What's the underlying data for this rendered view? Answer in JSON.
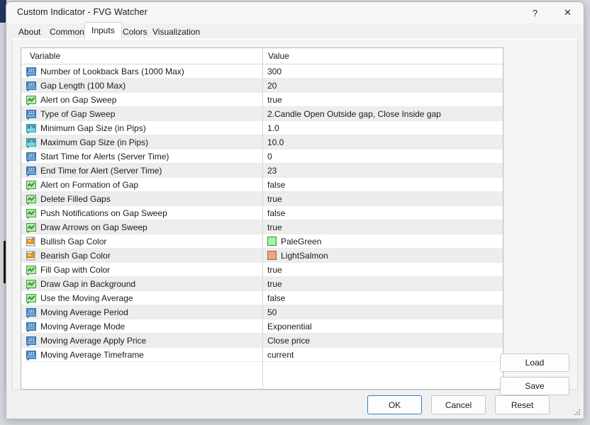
{
  "window": {
    "title": "Custom Indicator - FVG Watcher",
    "help_label": "?",
    "close_label": "✕"
  },
  "tabs": [
    {
      "label": "About",
      "selected": false
    },
    {
      "label": "Common",
      "selected": false
    },
    {
      "label": "Inputs",
      "selected": true
    },
    {
      "label": "Colors",
      "selected": false
    },
    {
      "label": "Visualization",
      "selected": false
    }
  ],
  "grid": {
    "headers": {
      "variable": "Variable",
      "value": "Value"
    },
    "rows": [
      {
        "icon": "integer-icon",
        "variable": "Number of Lookback Bars (1000 Max)",
        "value": "300"
      },
      {
        "icon": "integer-icon",
        "variable": "Gap Length (100 Max)",
        "value": "20"
      },
      {
        "icon": "boolean-icon",
        "variable": "Alert on Gap Sweep",
        "value": "true"
      },
      {
        "icon": "integer-icon",
        "variable": "Type of Gap Sweep",
        "value": "2.Candle Open Outside gap, Close Inside gap"
      },
      {
        "icon": "double-icon",
        "variable": "Minimum Gap Size (in Pips)",
        "value": "1.0"
      },
      {
        "icon": "double-icon",
        "variable": "Maximum Gap Size (in Pips)",
        "value": "10.0"
      },
      {
        "icon": "integer-icon",
        "variable": "Start Time for Alerts (Server Time)",
        "value": "0"
      },
      {
        "icon": "integer-icon",
        "variable": "End Time for Alert (Server Time)",
        "value": "23"
      },
      {
        "icon": "boolean-icon",
        "variable": "Alert on Formation of Gap",
        "value": "false"
      },
      {
        "icon": "boolean-icon",
        "variable": "Delete Filled Gaps",
        "value": "true"
      },
      {
        "icon": "boolean-icon",
        "variable": "Push Notifications on Gap Sweep",
        "value": "false"
      },
      {
        "icon": "boolean-icon",
        "variable": "Draw Arrows on Gap Sweep",
        "value": "true"
      },
      {
        "icon": "color-icon",
        "variable": "Bullish Gap Color",
        "value": "PaleGreen",
        "swatch": "#98FB98"
      },
      {
        "icon": "color-icon",
        "variable": "Bearish Gap Color",
        "value": "LightSalmon",
        "swatch": "#FFA07A"
      },
      {
        "icon": "boolean-icon",
        "variable": "Fill Gap with Color",
        "value": "true"
      },
      {
        "icon": "boolean-icon",
        "variable": "Draw Gap in Background",
        "value": "true"
      },
      {
        "icon": "boolean-icon",
        "variable": "Use the Moving Average",
        "value": "false"
      },
      {
        "icon": "integer-icon",
        "variable": "Moving Average Period",
        "value": "50"
      },
      {
        "icon": "integer-icon",
        "variable": "Moving Average Mode",
        "value": "Exponential"
      },
      {
        "icon": "integer-icon",
        "variable": "Moving Average Apply Price",
        "value": "Close price"
      },
      {
        "icon": "integer-icon",
        "variable": "Moving Average Timeframe",
        "value": "current"
      }
    ]
  },
  "side_buttons": {
    "load_label": "Load",
    "save_label": "Save"
  },
  "footer_buttons": {
    "ok_label": "OK",
    "cancel_label": "Cancel",
    "reset_label": "Reset"
  },
  "colors": {
    "accent": "#2f7fd1",
    "bullish": "#98FB98",
    "bearish": "#FFA07A"
  }
}
